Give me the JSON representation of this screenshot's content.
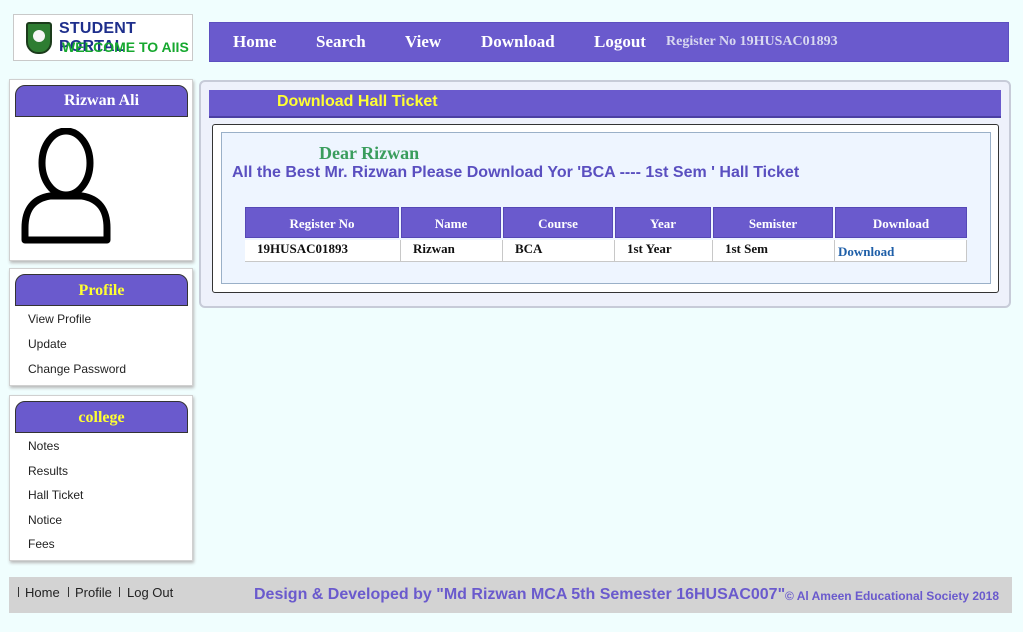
{
  "logo": {
    "line1": "STUDENT PORTAL",
    "line2": "WELCOME TO AIIS"
  },
  "nav": {
    "items": [
      "Home",
      "Search",
      "View",
      "Download",
      "Logout"
    ],
    "register_text": "Register No 19HUSAC01893"
  },
  "profile_card": {
    "name": "Rizwan Ali",
    "avatar_icon": "user-silhouette-icon"
  },
  "profile_menu": {
    "title": "Profile",
    "links": [
      "View Profile",
      "Update",
      "Change Password"
    ]
  },
  "college_menu": {
    "title": "college",
    "links": [
      "Notes",
      "Results",
      "Hall Ticket",
      "Notice",
      "Fees"
    ]
  },
  "main": {
    "title": "Download Hall Ticket",
    "greeting": "Dear Rizwan",
    "message": "All the Best Mr. Rizwan Please Download Yor 'BCA ---- 1st Sem ' Hall Ticket",
    "table": {
      "headers": [
        "Register No",
        "Name",
        "Course",
        "Year",
        "Semister",
        "Download"
      ],
      "row": [
        "19HUSAC01893",
        "Rizwan",
        "BCA",
        "1st Year",
        "1st Sem",
        "Download"
      ]
    }
  },
  "footer": {
    "links": [
      "Home",
      "Profile",
      "Log Out"
    ],
    "credit": "Design & Developed by \"Md Rizwan MCA 5th Semester 16HUSAC007\"",
    "copyright": "© Al Ameen Educational Society 2018"
  },
  "colors": {
    "accent": "#6a5acd",
    "yellow": "#ffff33",
    "green": "#3a9d5d",
    "page_bg": "#f0fefe"
  }
}
